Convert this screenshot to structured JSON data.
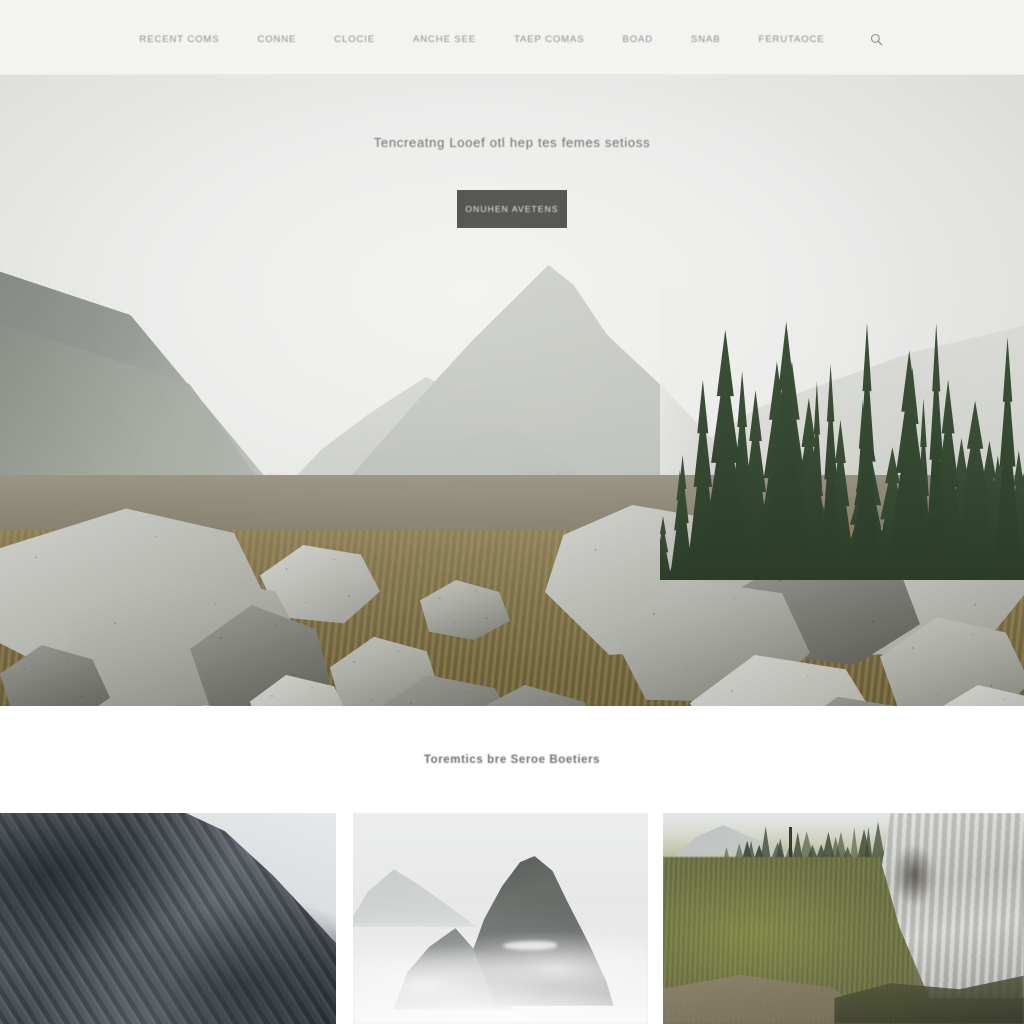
{
  "header": {
    "nav_items": [
      {
        "label": "Recent Coms"
      },
      {
        "label": "Conne"
      },
      {
        "label": "Clocie"
      },
      {
        "label": "Anche See"
      },
      {
        "label": "Taep Comas"
      },
      {
        "label": "Boad"
      },
      {
        "label": "Snab"
      },
      {
        "label": "Ferutaoce"
      }
    ],
    "search_icon": "search-icon",
    "background_color": "#f3f3f2",
    "nav_text_color": "#8e8e8c"
  },
  "hero": {
    "title": "Tencreatng Looef otl hep tes femes setioss",
    "cta_label": "Onuhen Avetens",
    "cta_bg": "#575754",
    "cta_text_color": "#e8e8e6",
    "title_color": "#6d6f6b",
    "image_alt": "Foggy alpine valley with granite boulders, dry grass and conifer forest"
  },
  "feature": {
    "title": "Toremtics bre Seroe Boetiers",
    "title_color": "#70726e",
    "background_color": "#ffffff"
  },
  "gallery": {
    "cards": [
      {
        "alt": "Dark striated scree slope against pale sky"
      },
      {
        "alt": "Misty mountain peak shrouded in fog"
      },
      {
        "alt": "Mossy alpine meadow with trail and pale rock face"
      }
    ]
  }
}
